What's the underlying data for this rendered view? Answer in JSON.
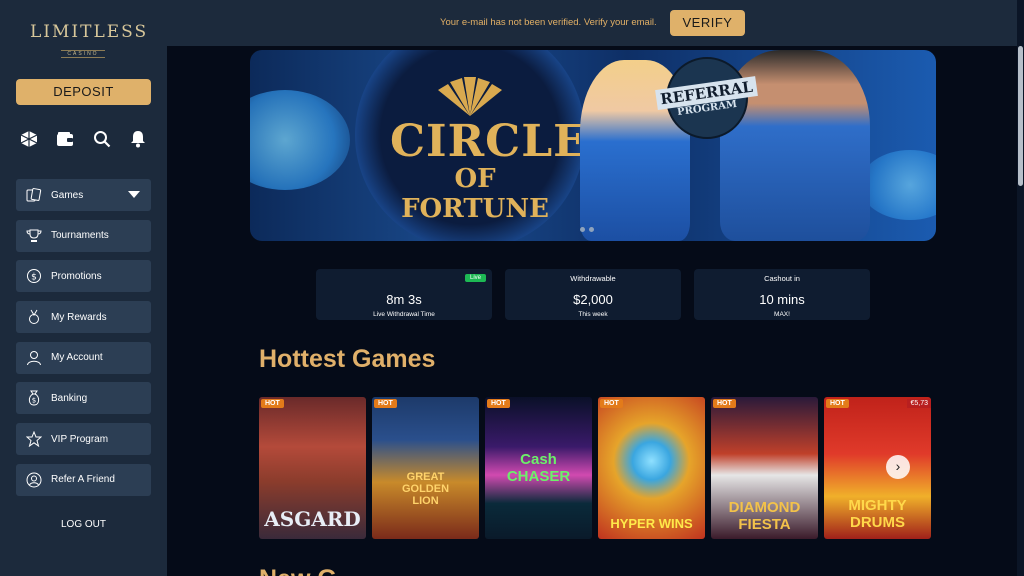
{
  "brand": {
    "name": "LIMITLESS",
    "tag": "CASINO"
  },
  "sidebar": {
    "deposit_label": "DEPOSIT",
    "quick_icons": [
      "cube-icon",
      "wallet-icon",
      "search-icon",
      "bell-icon"
    ],
    "items": [
      {
        "label": "Games",
        "icon": "cards-icon"
      },
      {
        "label": "Tournaments",
        "icon": "trophy-icon"
      },
      {
        "label": "Promotions",
        "icon": "dollar-coin-icon"
      },
      {
        "label": "My Rewards",
        "icon": "medal-icon"
      },
      {
        "label": "My Account",
        "icon": "user-icon"
      },
      {
        "label": "Banking",
        "icon": "money-bag-icon"
      },
      {
        "label": "VIP Program",
        "icon": "star-icon"
      },
      {
        "label": "Refer A Friend",
        "icon": "user-circle-icon"
      }
    ],
    "logout_label": "LOG OUT"
  },
  "topbar": {
    "message": "Your e-mail has not been verified. Verify your email.",
    "verify_label": "VERIFY"
  },
  "banner": {
    "title_line1": "CIRCLE",
    "title_line2": "OF FORTUNE",
    "badge_line1": "REFERRAL",
    "badge_line2": "PROGRAM"
  },
  "stats": [
    {
      "label": "",
      "value": "8m 3s",
      "sub": "Live Withdrawal Time",
      "badge": "Live"
    },
    {
      "label": "Withdrawable",
      "value": "$2,000",
      "sub": "This week"
    },
    {
      "label": "Cashout in",
      "value": "10 mins",
      "sub": "MAX!"
    }
  ],
  "sections": {
    "hottest": "Hottest Games",
    "next": "New G"
  },
  "games": [
    {
      "name": "ASGARD",
      "badge": "HOT"
    },
    {
      "name": "GREAT GOLDEN LION",
      "badge": "HOT"
    },
    {
      "name": "Cash CHASER",
      "badge": "HOT"
    },
    {
      "name": "HYPER WINS",
      "badge": "HOT"
    },
    {
      "name": "DIAMOND FIESTA",
      "badge": "HOT"
    },
    {
      "name": "MIGHTY DRUMS",
      "badge": "HOT",
      "jackpot": "€5,73"
    }
  ],
  "colors": {
    "accent": "#dfb16a",
    "sidebar": "#1c2a3c",
    "background": "#050b18",
    "live": "#1db954"
  }
}
